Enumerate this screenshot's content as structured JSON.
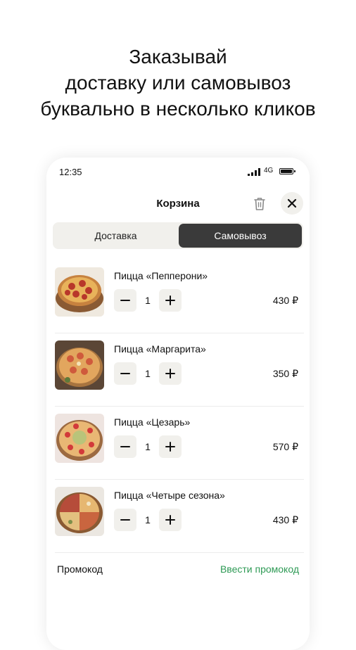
{
  "headline": {
    "line1": "Заказывай",
    "line2": "доставку или самовывоз",
    "line3": "буквально в несколько кликов"
  },
  "status_bar": {
    "time": "12:35",
    "network": "4G"
  },
  "header": {
    "title": "Корзина",
    "icons": [
      "trash-icon",
      "close-icon"
    ]
  },
  "tabs": [
    {
      "label": "Доставка",
      "selected": false
    },
    {
      "label": "Самовывоз",
      "selected": true
    }
  ],
  "cart": {
    "items": [
      {
        "name": "Пицца «Пепперони»",
        "quantity": "1",
        "price": "430 ₽"
      },
      {
        "name": "Пицца «Маргарита»",
        "quantity": "1",
        "price": "350 ₽"
      },
      {
        "name": "Пицца «Цезарь»",
        "quantity": "1",
        "price": "570 ₽"
      },
      {
        "name": "Пицца «Четыре сезона»",
        "quantity": "1",
        "price": "430 ₽"
      }
    ]
  },
  "promo": {
    "label": "Промокод",
    "action": "Ввести промокод"
  },
  "colors": {
    "accent_green": "#2e9a55",
    "selected_tab": "#3a3a3a",
    "control_bg": "#f1f0ec"
  }
}
